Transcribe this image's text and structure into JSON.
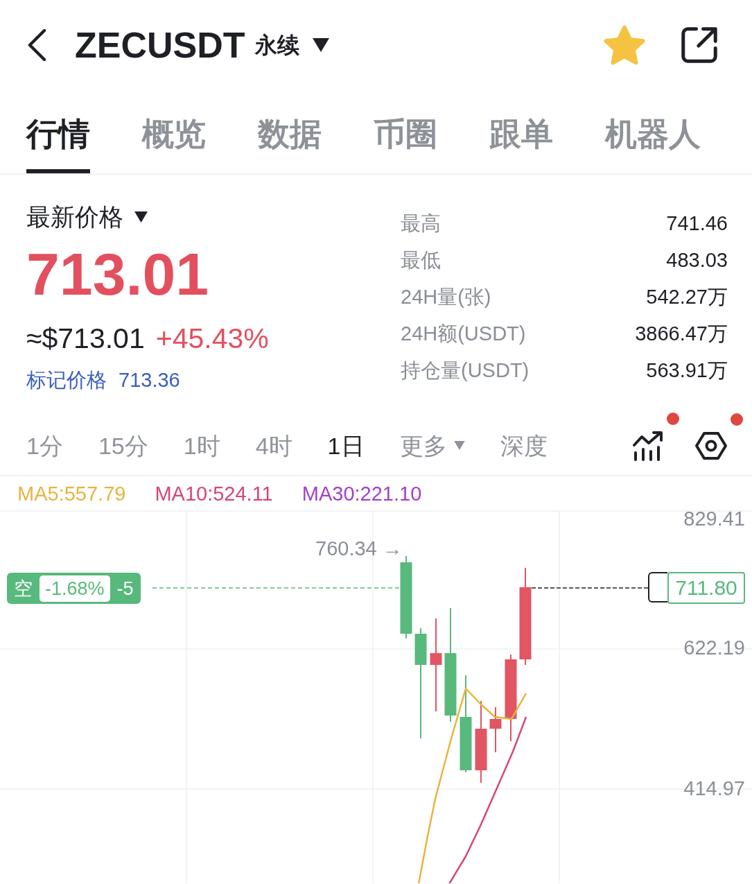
{
  "header": {
    "title": "ZECUSDT",
    "contract_type": "永续",
    "favorited": true
  },
  "tabs": [
    {
      "label": "行情",
      "selected": true
    },
    {
      "label": "概览",
      "selected": false
    },
    {
      "label": "数据",
      "selected": false
    },
    {
      "label": "币圈",
      "selected": false
    },
    {
      "label": "跟单",
      "selected": false
    },
    {
      "label": "机器人",
      "selected": false
    }
  ],
  "price_panel": {
    "price_label": "最新价格",
    "last_price": "713.01",
    "usd_price": "≈$713.01",
    "change": "+45.43%",
    "mark_price_label": "标记价格",
    "mark_price": "713.36"
  },
  "stats": [
    {
      "label": "最高",
      "value": "741.46"
    },
    {
      "label": "最低",
      "value": "483.03"
    },
    {
      "label": "24H量(张)",
      "value": "542.27万"
    },
    {
      "label": "24H额(USDT)",
      "value": "3866.47万"
    },
    {
      "label": "持仓量(USDT)",
      "value": "563.91万"
    }
  ],
  "timeframes": [
    {
      "label": "1分",
      "selected": false,
      "kind": "interval"
    },
    {
      "label": "15分",
      "selected": false,
      "kind": "interval"
    },
    {
      "label": "1时",
      "selected": false,
      "kind": "interval"
    },
    {
      "label": "4时",
      "selected": false,
      "kind": "interval"
    },
    {
      "label": "1日",
      "selected": true,
      "kind": "interval"
    },
    {
      "label": "更多",
      "selected": false,
      "kind": "menu"
    },
    {
      "label": "深度",
      "selected": false,
      "kind": "interval"
    }
  ],
  "chart_tools": [
    {
      "kind": "indicators",
      "badge": true
    },
    {
      "kind": "settings",
      "badge": true
    }
  ],
  "chart": {
    "moving_averages": [
      {
        "label": "MA5:557.79",
        "color": "#e8b33e"
      },
      {
        "label": "MA10:524.11",
        "color": "#d6457a"
      },
      {
        "label": "MA30:221.10",
        "color": "#a63fc6"
      }
    ],
    "y_axis": [
      "829.41",
      "622.19",
      "414.97"
    ],
    "high_label": "760.34 →",
    "position": {
      "side": "空",
      "pnl": "-1.68%",
      "quantity": "-5"
    },
    "last_price": "711.80"
  }
}
